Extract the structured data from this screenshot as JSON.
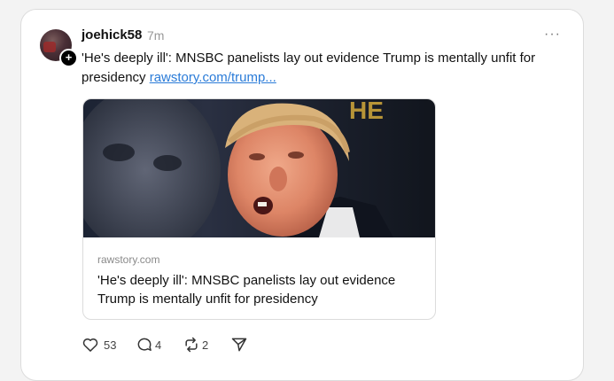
{
  "post": {
    "username": "joehick58",
    "time": "7m",
    "more_label": "···",
    "follow_label": "+",
    "text": "'He's deeply ill': MNSBC panelists lay out evidence Trump is mentally unfit for presidency",
    "link_text": "rawstory.com/trump..."
  },
  "link_card": {
    "domain": "rawstory.com",
    "title": "'He's deeply ill': MNSBC panelists lay out evidence Trump is mentally unfit for presidency"
  },
  "actions": {
    "likes": "53",
    "replies": "4",
    "reposts": "2"
  },
  "icons": [
    "heart-icon",
    "comment-icon",
    "repost-icon",
    "share-icon"
  ],
  "colors": {
    "link": "#2a7bd8",
    "muted": "#999999"
  }
}
